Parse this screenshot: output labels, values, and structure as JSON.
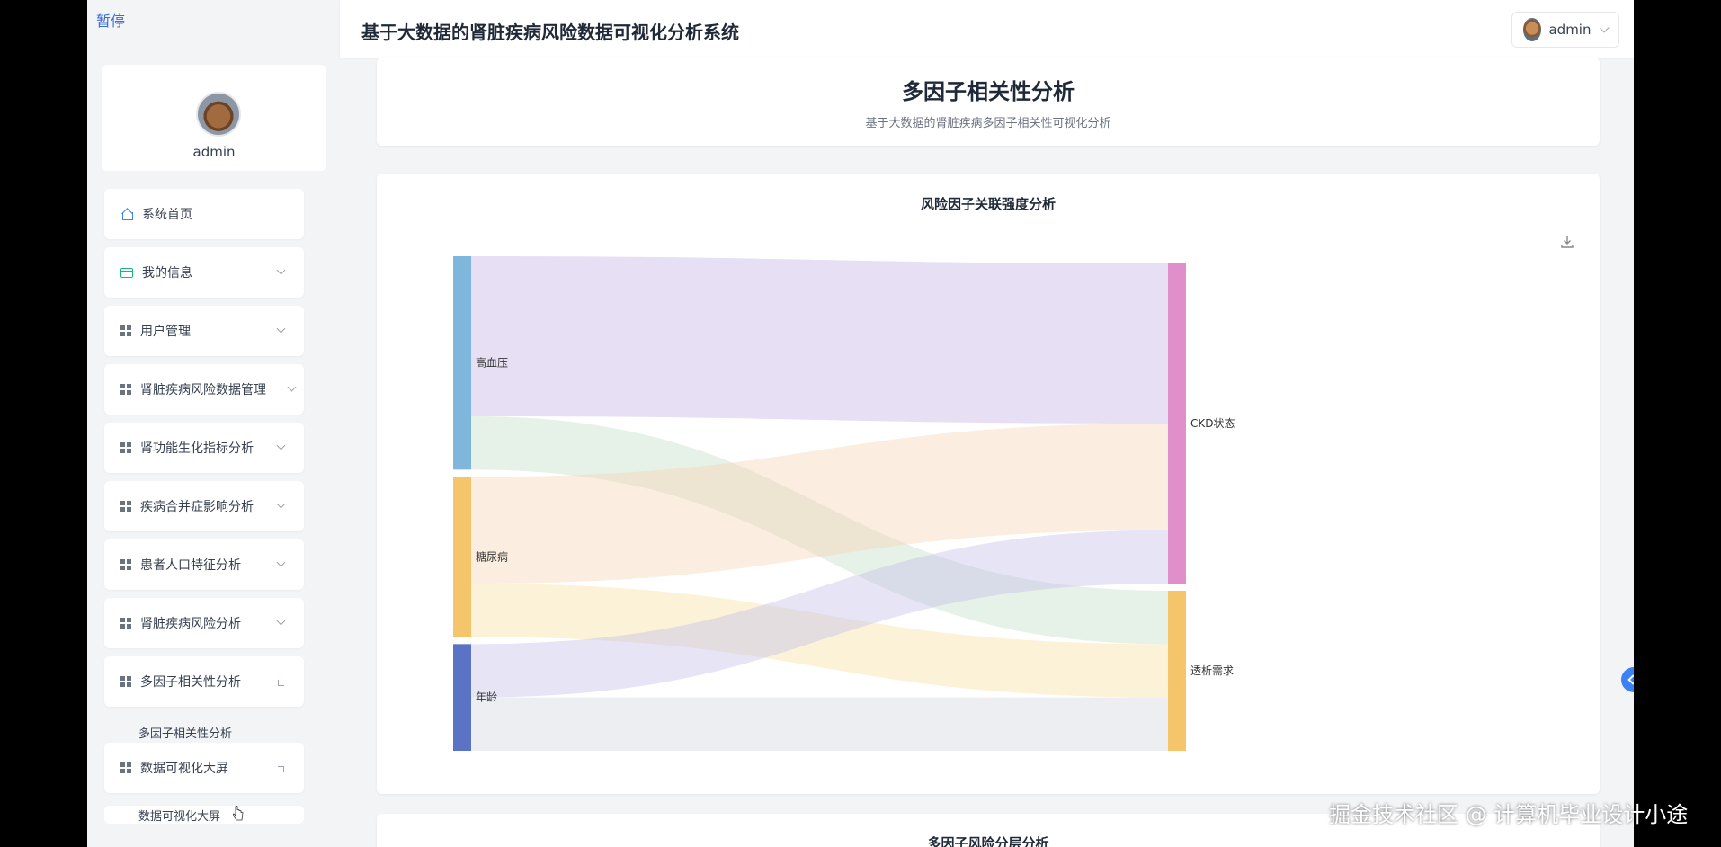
{
  "overlay": {
    "paused_label": "暂停",
    "watermark": "掘金技术社区 @ 计算机毕业设计小途"
  },
  "topbar": {
    "title": "基于大数据的肾脏疾病风险数据可视化分析系统",
    "user_name": "admin"
  },
  "profile": {
    "name": "admin"
  },
  "sidebar": {
    "items": [
      {
        "label": "系统首页",
        "icon": "home-icon"
      },
      {
        "label": "我的信息",
        "icon": "card-icon"
      },
      {
        "label": "用户管理",
        "icon": "grid-icon"
      },
      {
        "label": "肾脏疾病风险数据管理",
        "icon": "grid-icon"
      },
      {
        "label": "肾功能生化指标分析",
        "icon": "grid-icon"
      },
      {
        "label": "疾病合并症影响分析",
        "icon": "grid-icon"
      },
      {
        "label": "患者人口特征分析",
        "icon": "grid-icon"
      },
      {
        "label": "肾脏疾病风险分析",
        "icon": "grid-icon"
      },
      {
        "label": "多因子相关性分析",
        "icon": "grid-icon"
      },
      {
        "label": "数据可视化大屏",
        "icon": "grid-icon"
      }
    ],
    "subitems": {
      "correlation": "多因子相关性分析",
      "screen": "数据可视化大屏"
    }
  },
  "header": {
    "title": "多因子相关性分析",
    "subtitle": "基于大数据的肾脏疾病多因子相关性可视化分析"
  },
  "bottom": {
    "title": "多因子风险分层分析"
  },
  "chart_data": {
    "type": "sankey",
    "title": "风险因子关联强度分析",
    "nodes": [
      {
        "name": "高血压",
        "color": "#7eb6dc"
      },
      {
        "name": "糖尿病",
        "color": "#f4c56a"
      },
      {
        "name": "年龄",
        "color": "#5b73c4"
      },
      {
        "name": "CKD状态",
        "color": "#e08fcb"
      },
      {
        "name": "透析需求",
        "color": "#f4c56a"
      }
    ],
    "links": [
      {
        "source": "高血压",
        "target": "CKD状态",
        "value": 30,
        "color": "#c9b8e6"
      },
      {
        "source": "高血压",
        "target": "透析需求",
        "value": 10,
        "color": "#c8dfc9"
      },
      {
        "source": "糖尿病",
        "target": "CKD状态",
        "value": 20,
        "color": "#f6d6b8"
      },
      {
        "source": "糖尿病",
        "target": "透析需求",
        "value": 10,
        "color": "#f8e3a8"
      },
      {
        "source": "年龄",
        "target": "CKD状态",
        "value": 10,
        "color": "#c8c3e8"
      },
      {
        "source": "年龄",
        "target": "透析需求",
        "value": 10,
        "color": "#d8d9e3"
      }
    ]
  }
}
